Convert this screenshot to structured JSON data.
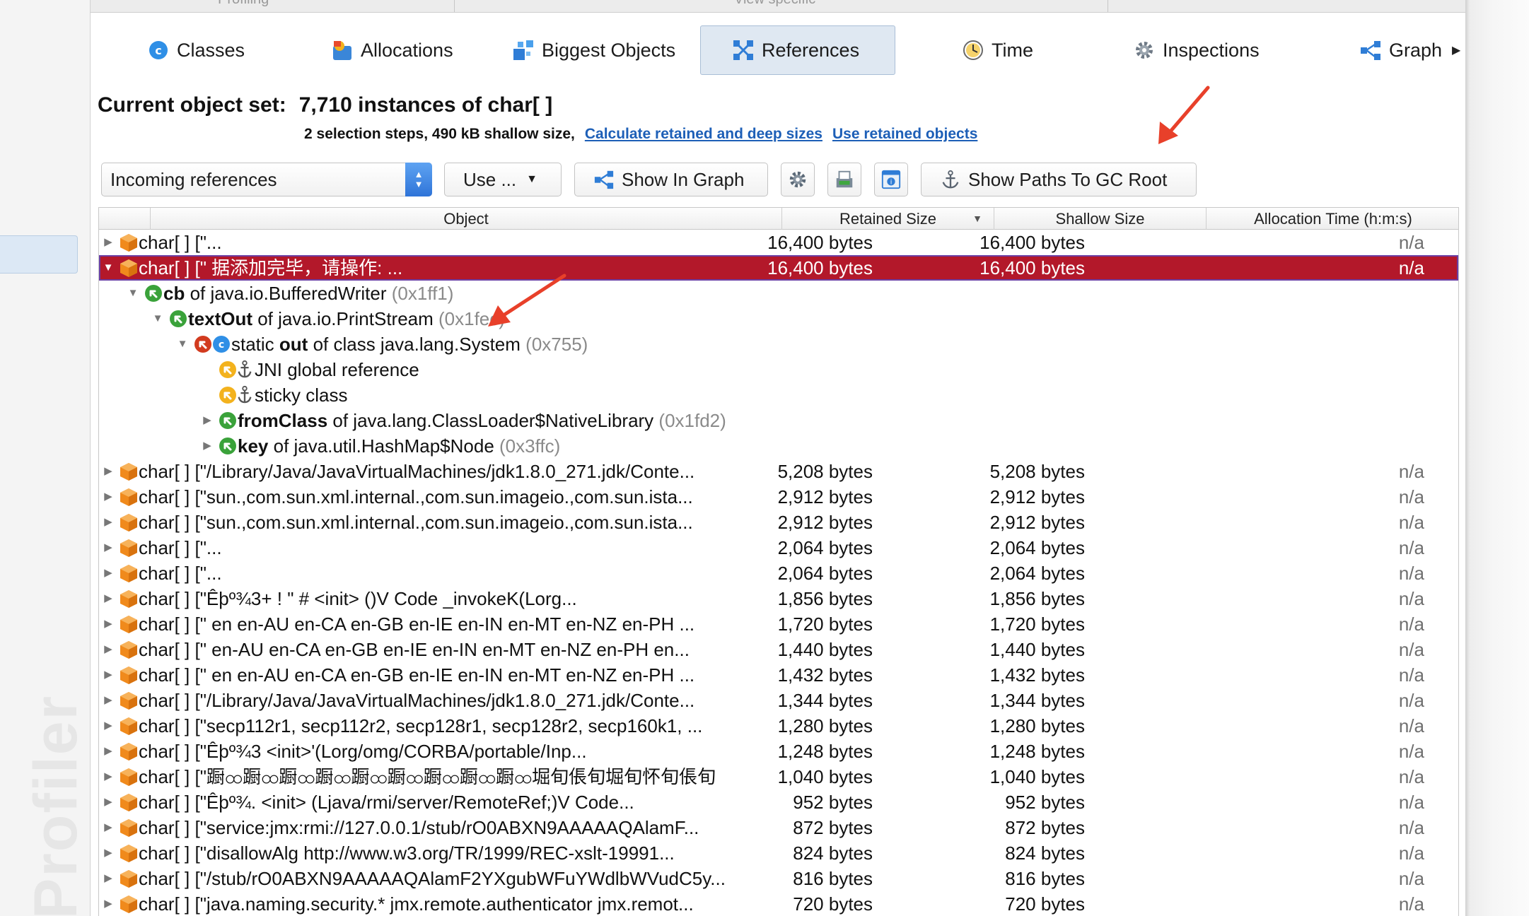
{
  "top_strip": {
    "section_left": "Profiling",
    "section_right": "View specific"
  },
  "tabs": [
    {
      "label": "Classes",
      "icon": "classes-icon"
    },
    {
      "label": "Allocations",
      "icon": "allocations-icon"
    },
    {
      "label": "Biggest Objects",
      "icon": "biggest-objects-icon"
    },
    {
      "label": "References",
      "icon": "references-icon",
      "active": true
    },
    {
      "label": "Time",
      "icon": "clock-icon"
    },
    {
      "label": "Inspections",
      "icon": "gear-icon"
    },
    {
      "label": "Graph",
      "icon": "graph-icon"
    }
  ],
  "header": {
    "label": "Current object set:",
    "value": "7,710 instances of char[ ]",
    "summary": "2 selection steps, 490 kB shallow size,",
    "link_calculate": "Calculate retained and deep sizes",
    "link_use_retained": "Use retained objects"
  },
  "controls": {
    "reference_mode": "Incoming references",
    "use_button": "Use ...",
    "show_in_graph": "Show In Graph",
    "show_paths_gc_root": "Show Paths To GC Root"
  },
  "table": {
    "columns": {
      "object": "Object",
      "retained": "Retained Size",
      "shallow": "Shallow Size",
      "alloc_time": "Allocation Time (h:m:s)"
    },
    "rows": [
      {
        "depth": 0,
        "expander": "right",
        "icon": "cube",
        "segments": [
          {
            "t": "char[ ] [\"..."
          }
        ],
        "retained": "16,400 bytes",
        "shallow": "16,400 bytes",
        "alloc": "n/a"
      },
      {
        "depth": 0,
        "expander": "down",
        "icon": "cube",
        "selected": true,
        "segments": [
          {
            "t": "char[ ] [\" 据添加完毕，请操作: ..."
          }
        ],
        "retained": "16,400 bytes",
        "shallow": "16,400 bytes",
        "alloc": "n/a"
      },
      {
        "depth": 1,
        "expander": "down",
        "icon": "ref-green",
        "segments": [
          {
            "t": "cb",
            "b": true
          },
          {
            "t": " of java.io.BufferedWriter "
          },
          {
            "t": "(0x1ff1)",
            "a": true
          }
        ],
        "retained": "",
        "shallow": "",
        "alloc": ""
      },
      {
        "depth": 2,
        "expander": "down",
        "icon": "ref-green",
        "segments": [
          {
            "t": "textOut",
            "b": true
          },
          {
            "t": " of java.io.PrintStream "
          },
          {
            "t": "(0x1fec)",
            "a": true
          }
        ],
        "retained": "",
        "shallow": "",
        "alloc": ""
      },
      {
        "depth": 3,
        "expander": "down",
        "icon": "ref-red-class",
        "segments": [
          {
            "t": "static "
          },
          {
            "t": "out",
            "b": true
          },
          {
            "t": " of class java.lang.System "
          },
          {
            "t": "(0x755)",
            "a": true
          }
        ],
        "retained": "",
        "shallow": "",
        "alloc": ""
      },
      {
        "depth": 4,
        "expander": "none",
        "icon": "gc-root",
        "segments": [
          {
            "t": "JNI global reference"
          }
        ],
        "retained": "",
        "shallow": "",
        "alloc": ""
      },
      {
        "depth": 4,
        "expander": "none",
        "icon": "gc-root",
        "segments": [
          {
            "t": "sticky class"
          }
        ],
        "retained": "",
        "shallow": "",
        "alloc": ""
      },
      {
        "depth": 4,
        "expander": "right",
        "icon": "ref-green",
        "segments": [
          {
            "t": "fromClass",
            "b": true
          },
          {
            "t": " of java.lang.ClassLoader$NativeLibrary "
          },
          {
            "t": "(0x1fd2)",
            "a": true
          }
        ],
        "retained": "",
        "shallow": "",
        "alloc": ""
      },
      {
        "depth": 4,
        "expander": "right",
        "icon": "ref-green",
        "segments": [
          {
            "t": "key",
            "b": true
          },
          {
            "t": " of java.util.HashMap$Node "
          },
          {
            "t": "(0x3ffc)",
            "a": true
          }
        ],
        "retained": "",
        "shallow": "",
        "alloc": ""
      },
      {
        "depth": 0,
        "expander": "right",
        "icon": "cube",
        "segments": [
          {
            "t": "char[ ] [\"/Library/Java/JavaVirtualMachines/jdk1.8.0_271.jdk/Conte..."
          }
        ],
        "retained": "5,208 bytes",
        "shallow": "5,208 bytes",
        "alloc": "n/a"
      },
      {
        "depth": 0,
        "expander": "right",
        "icon": "cube",
        "segments": [
          {
            "t": "char[ ] [\"sun.,com.sun.xml.internal.,com.sun.imageio.,com.sun.ista..."
          }
        ],
        "retained": "2,912 bytes",
        "shallow": "2,912 bytes",
        "alloc": "n/a"
      },
      {
        "depth": 0,
        "expander": "right",
        "icon": "cube",
        "segments": [
          {
            "t": "char[ ] [\"sun.,com.sun.xml.internal.,com.sun.imageio.,com.sun.ista..."
          }
        ],
        "retained": "2,912 bytes",
        "shallow": "2,912 bytes",
        "alloc": "n/a"
      },
      {
        "depth": 0,
        "expander": "right",
        "icon": "cube",
        "segments": [
          {
            "t": "char[ ] [\"..."
          }
        ],
        "retained": "2,064 bytes",
        "shallow": "2,064 bytes",
        "alloc": "n/a"
      },
      {
        "depth": 0,
        "expander": "right",
        "icon": "cube",
        "segments": [
          {
            "t": "char[ ] [\"..."
          }
        ],
        "retained": "2,064 bytes",
        "shallow": "2,064 bytes",
        "alloc": "n/a"
      },
      {
        "depth": 0,
        "expander": "right",
        "icon": "cube",
        "segments": [
          {
            "t": "char[ ] [\"Êþº¾3+                          ! \" # <init> ()V Code _invokeK(Lorg..."
          }
        ],
        "retained": "1,856 bytes",
        "shallow": "1,856 bytes",
        "alloc": "n/a"
      },
      {
        "depth": 0,
        "expander": "right",
        "icon": "cube",
        "segments": [
          {
            "t": "char[ ] [\" en en-AU en-CA en-GB en-IE en-IN en-MT en-NZ en-PH ..."
          }
        ],
        "retained": "1,720 bytes",
        "shallow": "1,720 bytes",
        "alloc": "n/a"
      },
      {
        "depth": 0,
        "expander": "right",
        "icon": "cube",
        "segments": [
          {
            "t": "char[ ] [\"  en-AU en-CA en-GB en-IE en-IN en-MT en-NZ en-PH en..."
          }
        ],
        "retained": "1,440 bytes",
        "shallow": "1,440 bytes",
        "alloc": "n/a"
      },
      {
        "depth": 0,
        "expander": "right",
        "icon": "cube",
        "segments": [
          {
            "t": "char[ ] [\"  en en-AU en-CA en-GB en-IE en-IN en-MT en-NZ en-PH ..."
          }
        ],
        "retained": "1,432 bytes",
        "shallow": "1,432 bytes",
        "alloc": "n/a"
      },
      {
        "depth": 0,
        "expander": "right",
        "icon": "cube",
        "segments": [
          {
            "t": "char[ ] [\"/Library/Java/JavaVirtualMachines/jdk1.8.0_271.jdk/Conte..."
          }
        ],
        "retained": "1,344 bytes",
        "shallow": "1,344 bytes",
        "alloc": "n/a"
      },
      {
        "depth": 0,
        "expander": "right",
        "icon": "cube",
        "segments": [
          {
            "t": "char[ ] [\"secp112r1, secp112r2, secp128r1, secp128r2, secp160k1, ..."
          }
        ],
        "retained": "1,280 bytes",
        "shallow": "1,280 bytes",
        "alloc": "n/a"
      },
      {
        "depth": 0,
        "expander": "right",
        "icon": "cube",
        "segments": [
          {
            "t": "char[ ] [\"Êþº¾3                   <init>'(Lorg/omg/CORBA/portable/Inp..."
          }
        ],
        "retained": "1,248 bytes",
        "shallow": "1,248 bytes",
        "alloc": "n/a"
      },
      {
        "depth": 0,
        "expander": "right",
        "icon": "cube",
        "segments": [
          {
            "t": "char[ ] [\"蹰ထ蹰ထ蹰ထ蹰ထ蹰ထ蹰ထ蹰ထ蹰ထ蹰ထ堀旬倀旬堀旬怀旬倀旬"
          }
        ],
        "retained": "1,040 bytes",
        "shallow": "1,040 bytes",
        "alloc": "n/a"
      },
      {
        "depth": 0,
        "expander": "right",
        "icon": "cube",
        "segments": [
          {
            "t": "char[ ] [\"Êþº¾.             <init> (Ljava/rmi/server/RemoteRef;)V Code..."
          }
        ],
        "retained": "952 bytes",
        "shallow": "952 bytes",
        "alloc": "n/a"
      },
      {
        "depth": 0,
        "expander": "right",
        "icon": "cube",
        "segments": [
          {
            "t": "char[ ] [\"service:jmx:rmi://127.0.0.1/stub/rO0ABXN9AAAAAQAlamF..."
          }
        ],
        "retained": "872 bytes",
        "shallow": "872 bytes",
        "alloc": "n/a"
      },
      {
        "depth": 0,
        "expander": "right",
        "icon": "cube",
        "segments": [
          {
            "t": "char[ ] [\"disallowAlg http://www.w3.org/TR/1999/REC-xslt-19991..."
          }
        ],
        "retained": "824 bytes",
        "shallow": "824 bytes",
        "alloc": "n/a"
      },
      {
        "depth": 0,
        "expander": "right",
        "icon": "cube",
        "segments": [
          {
            "t": "char[ ] [\"/stub/rO0ABXN9AAAAAQAlamF2YXgubWFuYWdlbWVudC5y..."
          }
        ],
        "retained": "816 bytes",
        "shallow": "816 bytes",
        "alloc": "n/a"
      },
      {
        "depth": 0,
        "expander": "right",
        "icon": "cube",
        "segments": [
          {
            "t": "char[ ] [\"java.naming.security.* jmx.remote.authenticator jmx.remot..."
          }
        ],
        "retained": "720 bytes",
        "shallow": "720 bytes",
        "alloc": "n/a"
      }
    ]
  },
  "sidebar": {
    "brand": "Profiler"
  },
  "colors": {
    "selected_row": "#b3182a",
    "link": "#1d5fb7",
    "cube": "#f08a1c",
    "ref_green": "#3aa23a",
    "ref_red": "#d23b1f",
    "annotation_arrow": "#e8402a"
  }
}
